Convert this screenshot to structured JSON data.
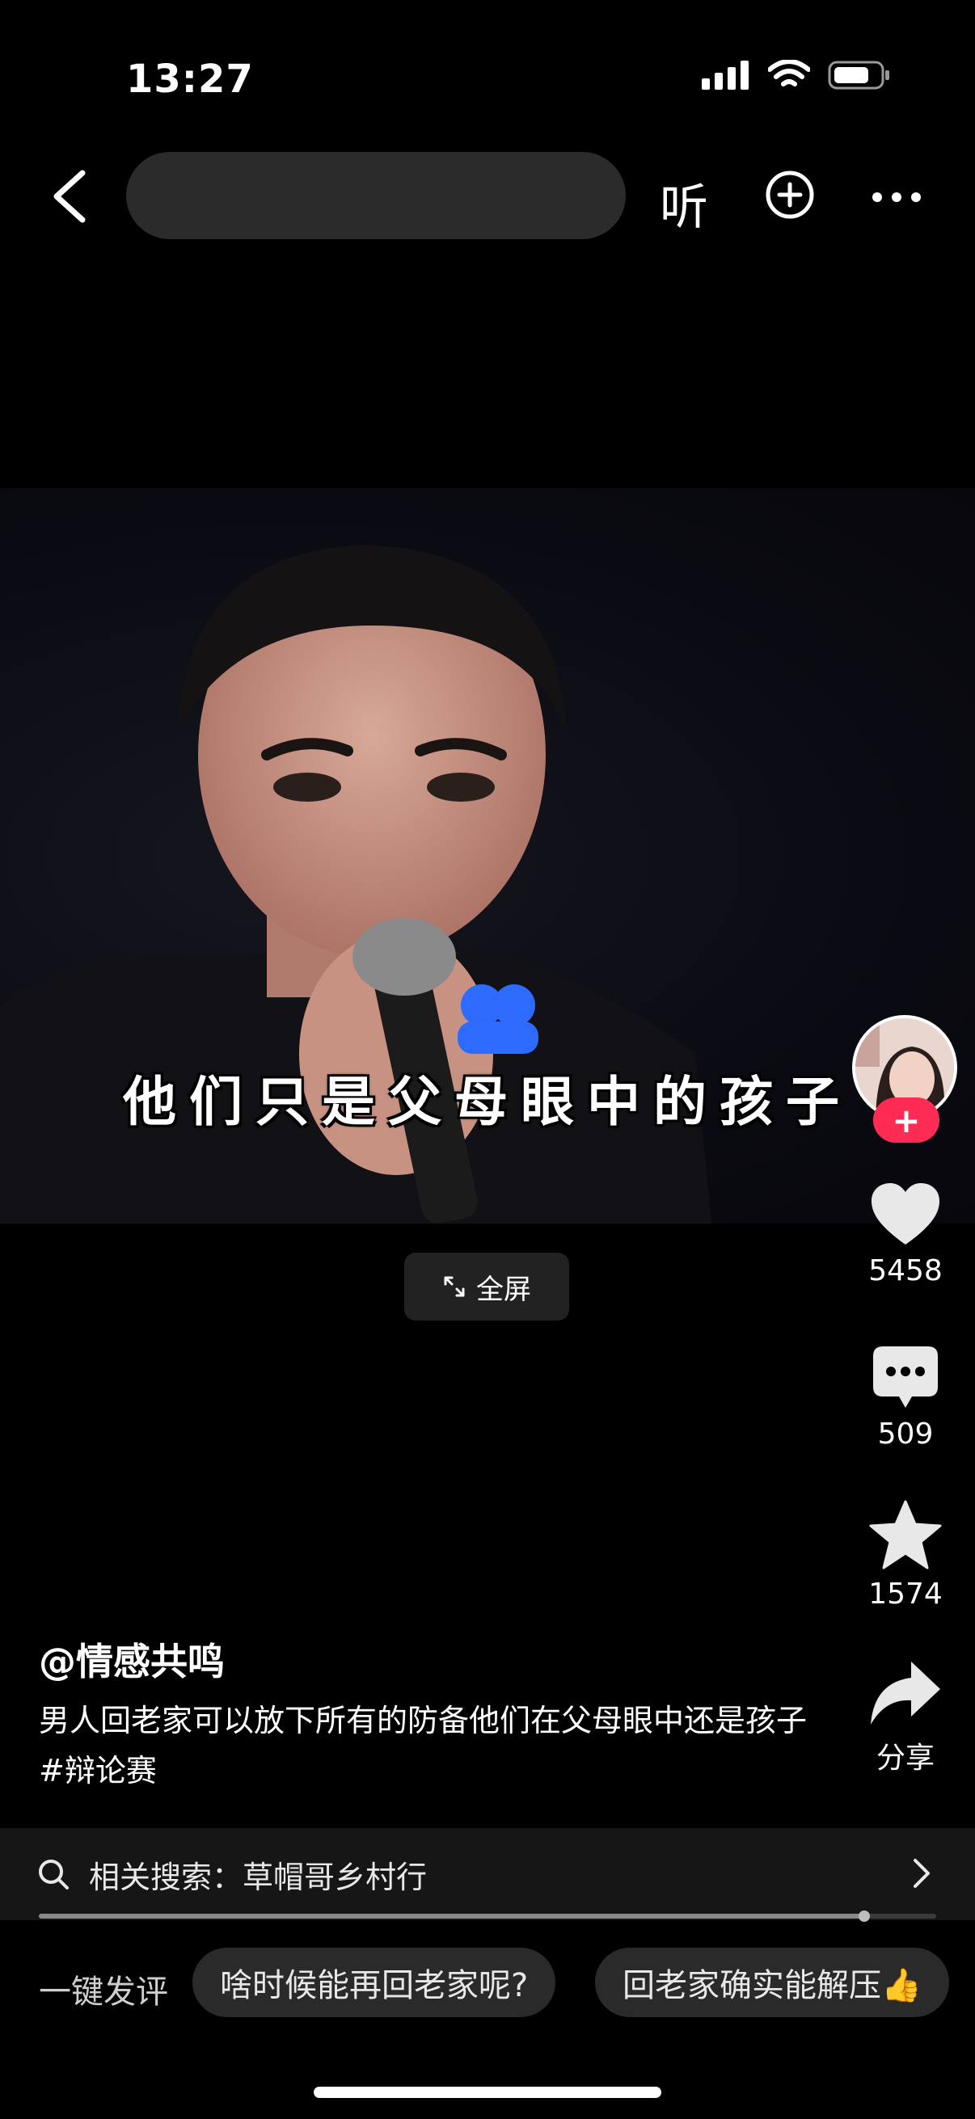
{
  "status_bar": {
    "time": "13:27"
  },
  "top_bar": {
    "search_placeholder": "",
    "listen_label": "听"
  },
  "video": {
    "subtitle": "他们只是父母眼中的孩子",
    "fullscreen_label": "全屏"
  },
  "right_rail": {
    "like_count": "5458",
    "comment_count": "509",
    "favorite_count": "1574",
    "share_label": "分享",
    "follow_symbol": "+"
  },
  "caption": {
    "author": "@情感共鸣",
    "description": "男人回老家可以放下所有的防备他们在父母眼中还是孩子#辩论赛"
  },
  "related_search": {
    "text": "相关搜索：草帽哥乡村行"
  },
  "playback": {
    "progress": 0.92
  },
  "quick_comment": {
    "label": "一键发评",
    "chips": [
      "啥时候能再回老家呢?",
      "回老家确实能解压👍"
    ]
  },
  "colors": {
    "accent": "#fe2c55",
    "background": "#000000"
  }
}
